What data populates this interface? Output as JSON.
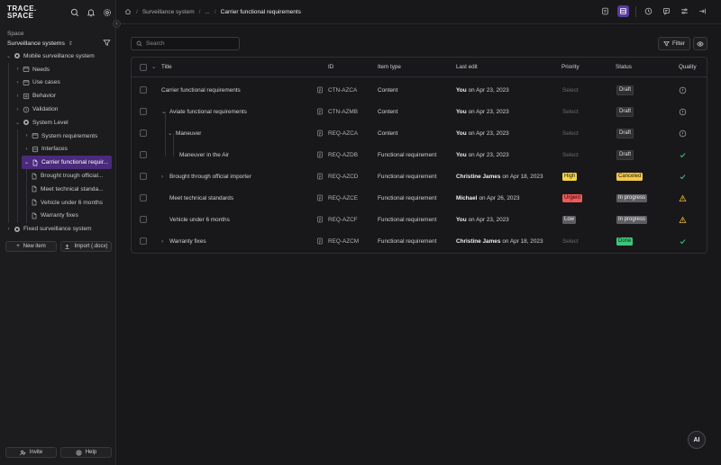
{
  "app": {
    "logo_line1": "TRACE.",
    "logo_line2": "SPACE"
  },
  "sidebar": {
    "space_label": "Space",
    "space_value": "Surveillance systems",
    "tree": [
      {
        "label": "Mobile surveillance system",
        "icon": "system-icon"
      },
      {
        "label": "Needs",
        "icon": "folder-icon"
      },
      {
        "label": "Use cases",
        "icon": "folder-icon"
      },
      {
        "label": "Behavior",
        "icon": "behavior-icon"
      },
      {
        "label": "Validation",
        "icon": "validation-icon"
      },
      {
        "label": "System Level",
        "icon": "system-icon"
      },
      {
        "label": "System requirements",
        "icon": "folder-icon"
      },
      {
        "label": "Interfaces",
        "icon": "interface-icon"
      },
      {
        "label": "Carrier functional requir...",
        "icon": "document-icon"
      },
      {
        "label": "Brought trough official...",
        "icon": "document-icon"
      },
      {
        "label": "Meet technical standa...",
        "icon": "document-icon"
      },
      {
        "label": "Vehicle under 6 months",
        "icon": "document-icon"
      },
      {
        "label": "Warranty fixes",
        "icon": "document-icon"
      },
      {
        "label": "Fixed surveillance system",
        "icon": "system-icon"
      }
    ],
    "new_item_label": "New item",
    "import_label": "Import (.docx)",
    "invite_label": "Invite",
    "help_label": "Help"
  },
  "header": {
    "breadcrumbs": [
      "Surveillance system",
      "...",
      "Carrier functional requirements"
    ]
  },
  "toolbar": {
    "search_placeholder": "Search",
    "filter_label": "Filter"
  },
  "table": {
    "columns": {
      "title": "Title",
      "id": "ID",
      "type": "Item type",
      "last_edit": "Last edit",
      "priority": "Priority",
      "status": "Status",
      "quality": "Quality"
    },
    "rows": [
      {
        "title": "Carrier functional requirements",
        "id": "CTN-AZCA",
        "type": "Content",
        "editor": "You",
        "date": "on Apr 23, 2023",
        "priority": "Select",
        "status": "Draft",
        "quality": "info"
      },
      {
        "title": "Aviate functional requirements",
        "id": "CTN-AZMB",
        "type": "Content",
        "editor": "You",
        "date": "on Apr 23, 2023",
        "priority": "Select",
        "status": "Draft",
        "quality": "info"
      },
      {
        "title": "Maneuver",
        "id": "REQ-AZCA",
        "type": "Content",
        "editor": "You",
        "date": "on Apr 23, 2023",
        "priority": "Select",
        "status": "Draft",
        "quality": "info"
      },
      {
        "title": "Maneuver in the Air",
        "id": "REQ-AZDB",
        "type": "Functional requirement",
        "editor": "You",
        "date": "on Apr 23, 2023",
        "priority": "Select",
        "status": "Draft",
        "quality": "ok"
      },
      {
        "title": "Brought through official importer",
        "id": "REQ-AZCD",
        "type": "Functional requirement",
        "editor": "Christine James",
        "date": "on Apr 18, 2023",
        "priority": "High",
        "status": "Canceled",
        "quality": "ok"
      },
      {
        "title": "Meet technical standards",
        "id": "REQ-AZCE",
        "type": "Functional requirement",
        "editor": "Michael",
        "date": "on Apr 26, 2023",
        "priority": "Urgent",
        "status": "In progress",
        "quality": "warning"
      },
      {
        "title": "Vehicle under 6 months",
        "id": "REQ-AZCF",
        "type": "Functional requirement",
        "editor": "You",
        "date": "on Apr 23, 2023",
        "priority": "Low",
        "status": "In progress",
        "quality": "warning"
      },
      {
        "title": "Warranty fixes",
        "id": "REQ-AZCM",
        "type": "Functional requirement",
        "editor": "Christine James",
        "date": "on Apr 18, 2023",
        "priority": "Select",
        "status": "Done",
        "quality": "ok"
      }
    ]
  },
  "ai_button": {
    "label": "AI"
  },
  "colors": {
    "accent": "#5b3aa0",
    "selected_tree": "#4a2a7a",
    "high": "#f3d34a",
    "urgent": "#ef5a5a",
    "done": "#3ec57a",
    "canceled": "#f3c94a",
    "warning": "#e0b23a",
    "ok": "#3ec57a"
  }
}
